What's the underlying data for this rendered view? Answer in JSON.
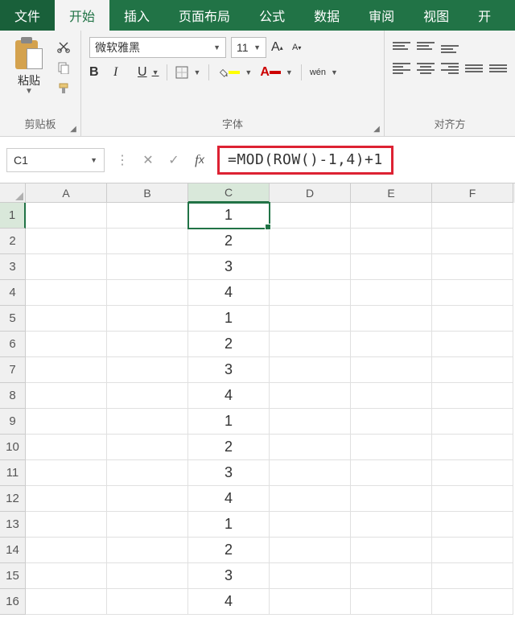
{
  "tabs": {
    "file": "文件",
    "home": "开始",
    "insert": "插入",
    "layout": "页面布局",
    "formulas": "公式",
    "data": "数据",
    "review": "审阅",
    "view": "视图",
    "extra": "开"
  },
  "ribbon": {
    "clipboard": {
      "paste": "粘贴",
      "label": "剪贴板"
    },
    "font": {
      "name": "微软雅黑",
      "size": "11",
      "bold": "B",
      "italic": "I",
      "underline": "U",
      "wen": "wén",
      "label": "字体",
      "grow_icon": "A",
      "shrink_icon": "A"
    },
    "align": {
      "label": "对齐方"
    }
  },
  "formula_bar": {
    "cell_ref": "C1",
    "formula": "=MOD(ROW()-1,4)+1"
  },
  "columns": [
    "A",
    "B",
    "C",
    "D",
    "E",
    "F"
  ],
  "active_col_index": 2,
  "active_row_index": 0,
  "rows": [
    {
      "n": "1",
      "c": "1"
    },
    {
      "n": "2",
      "c": "2"
    },
    {
      "n": "3",
      "c": "3"
    },
    {
      "n": "4",
      "c": "4"
    },
    {
      "n": "5",
      "c": "1"
    },
    {
      "n": "6",
      "c": "2"
    },
    {
      "n": "7",
      "c": "3"
    },
    {
      "n": "8",
      "c": "4"
    },
    {
      "n": "9",
      "c": "1"
    },
    {
      "n": "10",
      "c": "2"
    },
    {
      "n": "11",
      "c": "3"
    },
    {
      "n": "12",
      "c": "4"
    },
    {
      "n": "13",
      "c": "1"
    },
    {
      "n": "14",
      "c": "2"
    },
    {
      "n": "15",
      "c": "3"
    },
    {
      "n": "16",
      "c": "4"
    }
  ]
}
